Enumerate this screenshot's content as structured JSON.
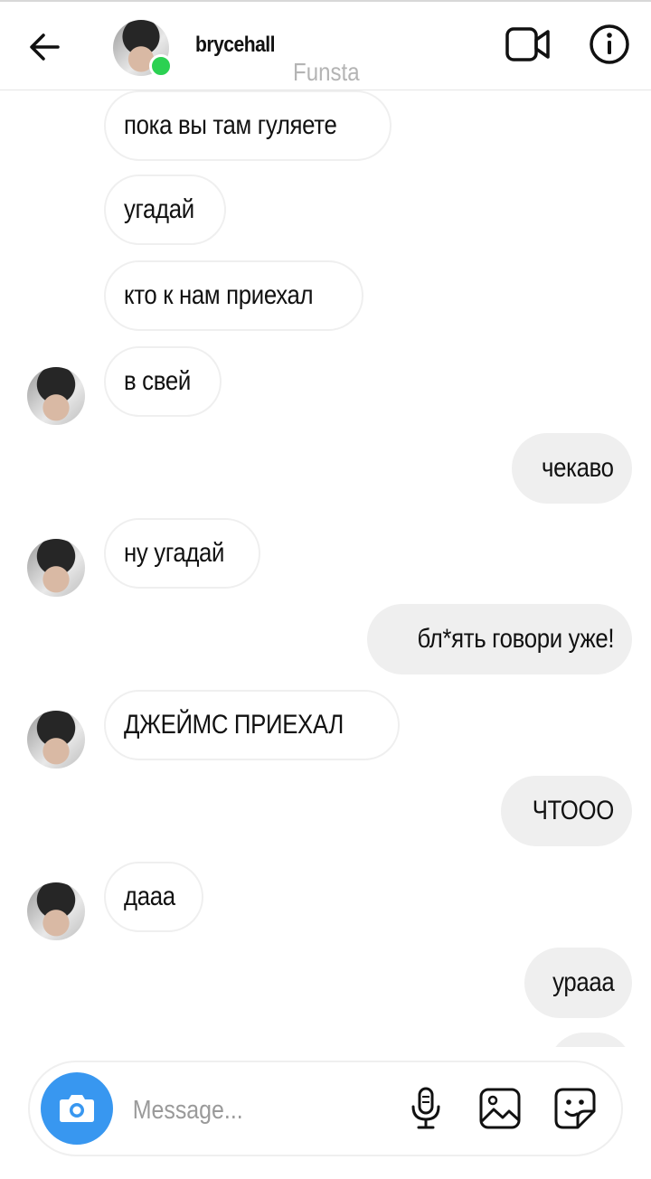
{
  "header": {
    "username": "brycehall",
    "watermark": "Funsta"
  },
  "icons": {
    "back": "back-arrow-icon",
    "video": "video-camera-icon",
    "info": "info-icon",
    "camera": "camera-icon",
    "mic": "microphone-icon",
    "gallery": "gallery-icon",
    "sticker": "sticker-icon"
  },
  "colors": {
    "accent": "#3897f0",
    "online": "#2bd152",
    "outgoing_bubble": "#efefef"
  },
  "messages": [
    {
      "text": "пока вы там гуляете",
      "from": "them"
    },
    {
      "text": "угадай",
      "from": "them"
    },
    {
      "text": "кто к нам приехал",
      "from": "them"
    },
    {
      "text": "в свей",
      "from": "them"
    },
    {
      "text": "чекаво",
      "from": "me"
    },
    {
      "text": "ну угадай",
      "from": "them"
    },
    {
      "text": "бл*ять говори уже!",
      "from": "me"
    },
    {
      "text": "ДЖЕЙМС ПРИЕХАЛ",
      "from": "them"
    },
    {
      "text": "ЧТООО",
      "from": "me"
    },
    {
      "text": "дааа",
      "from": "them"
    },
    {
      "text": "урааа",
      "from": "me"
    }
  ],
  "composer": {
    "placeholder": "Message..."
  }
}
